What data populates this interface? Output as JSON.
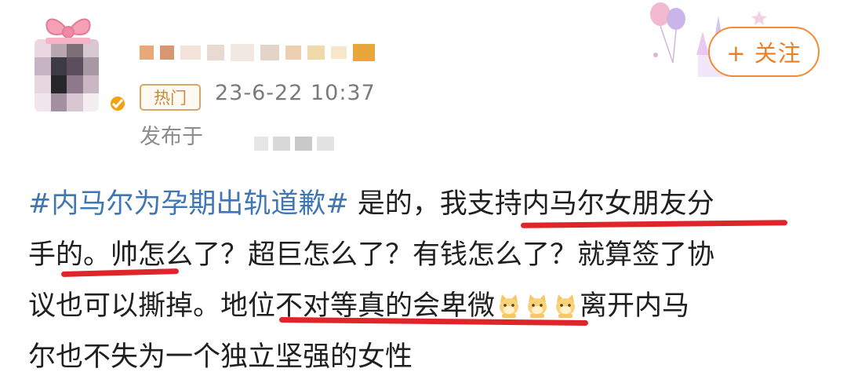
{
  "post": {
    "badge": "热门",
    "timestamp": "23-6-22 10:37",
    "publish_prefix": "发布于",
    "follow_label": "+ 关注",
    "hashtag": "#内马尔为孕期出轨道歉#",
    "lines": [
      " 是的，我支持内马尔女朋友分",
      "手的。帅怎么了？超巨怎么了？有钱怎么了？就算签了协",
      "议也可以撕掉。地位不对等真的会卑微",
      "离开内马",
      "尔也不失为一个独立坚强的女性"
    ]
  },
  "icons": {
    "avatar": "avatar",
    "bow": "gift-bow-icon",
    "verified": "verified-badge-icon",
    "emoji": "cat-emoji-icon",
    "decoration": "castle-balloon-icon"
  },
  "colors": {
    "hashtag": "#3f77b5",
    "follow": "#f07d22",
    "badge": "#c98a3a",
    "underline": "#e0252a"
  }
}
